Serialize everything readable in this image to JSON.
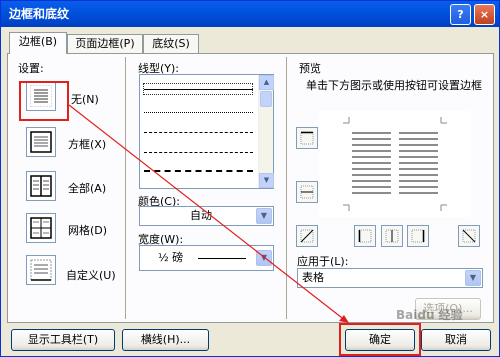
{
  "window": {
    "title": "边框和底纹",
    "help": "?",
    "close": "×"
  },
  "tabs": [
    {
      "label": "边框(B)"
    },
    {
      "label": "页面边框(P)"
    },
    {
      "label": "底纹(S)"
    }
  ],
  "settings": {
    "heading": "设置:",
    "items": [
      {
        "label": "无(N)"
      },
      {
        "label": "方框(X)"
      },
      {
        "label": "全部(A)"
      },
      {
        "label": "网格(D)"
      },
      {
        "label": "自定义(U)"
      }
    ],
    "selected": "无(N)"
  },
  "style": {
    "heading": "线型(Y):",
    "selected_index": 0
  },
  "color": {
    "heading": "颜色(C):",
    "value": "自动"
  },
  "width": {
    "heading": "宽度(W):",
    "value": "½ 磅"
  },
  "preview": {
    "heading": "预览",
    "hint": "单击下方图示或使用按钮可设置边框"
  },
  "apply_to": {
    "heading": "应用于(L):",
    "value": "表格"
  },
  "buttons": {
    "options": "选项(O)...",
    "toolbar": "显示工具栏(T)",
    "horizontal_line": "横线(H)...",
    "ok": "确定",
    "cancel": "取消"
  },
  "watermark": "Baidu 经验",
  "colors": {
    "accent": "#e0201c",
    "title": "#0054e3",
    "dialog": "#ece9d8"
  }
}
